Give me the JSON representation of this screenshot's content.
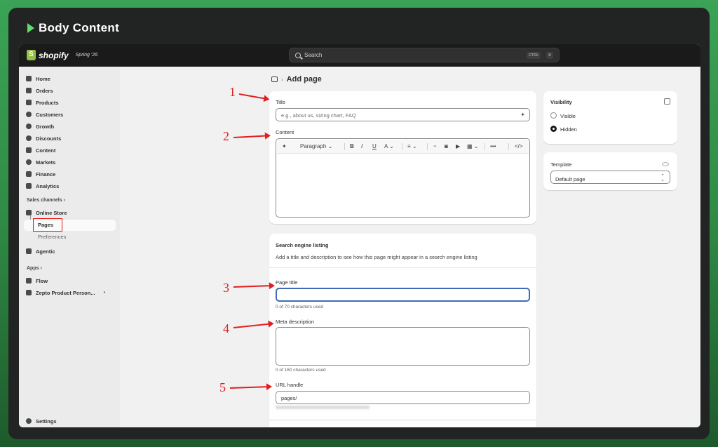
{
  "frame": {
    "title": "Body Content"
  },
  "topbar": {
    "brand": "shopify",
    "edition": "Spring '26",
    "search_placeholder": "Search",
    "kbd_1": "CTRL",
    "kbd_2": "K"
  },
  "sidebar": {
    "items": [
      {
        "label": "Home",
        "icon": "home-icon"
      },
      {
        "label": "Orders",
        "icon": "inbox-icon"
      },
      {
        "label": "Products",
        "icon": "tag-icon"
      },
      {
        "label": "Customers",
        "icon": "person-icon"
      },
      {
        "label": "Growth",
        "icon": "gauge-icon"
      },
      {
        "label": "Discounts",
        "icon": "discount-icon"
      },
      {
        "label": "Content",
        "icon": "content-icon"
      },
      {
        "label": "Markets",
        "icon": "globe-icon"
      },
      {
        "label": "Finance",
        "icon": "bank-icon"
      },
      {
        "label": "Analytics",
        "icon": "chart-icon"
      }
    ],
    "sales_channels_label": "Sales channels",
    "online_store": "Online Store",
    "pages": "Pages",
    "preferences": "Preferences",
    "agentic": "Agentic",
    "apps_label": "Apps",
    "flow": "Flow",
    "zepto": "Zepto Product Person...",
    "settings": "Settings"
  },
  "breadcrumb": {
    "title": "Add page",
    "sep": "›"
  },
  "main": {
    "title_label": "Title",
    "title_placeholder": "e.g., about us, sizing chart, FAQ",
    "content_label": "Content",
    "toolbar": {
      "paragraph": "Paragraph",
      "bold": "B",
      "italic": "I",
      "underline": "U",
      "color": "A",
      "more": "•••",
      "code": "</>"
    },
    "seo_heading": "Search engine listing",
    "seo_desc": "Add a title and description to see how this page might appear in a search engine listing",
    "page_title_label": "Page title",
    "page_title_help": "0 of 70 characters used",
    "meta_label": "Meta description",
    "meta_help": "0 of 160 characters used",
    "url_label": "URL handle",
    "url_value": "pages/"
  },
  "visibility": {
    "heading": "Visibility",
    "options": [
      "Visible",
      "Hidden"
    ],
    "selected": "Hidden"
  },
  "template": {
    "heading": "Template",
    "value": "Default page"
  },
  "annotations": [
    "1",
    "2",
    "3",
    "4",
    "5"
  ],
  "colors": {
    "annotation": "#e02020",
    "brand_green": "#95bf47"
  }
}
